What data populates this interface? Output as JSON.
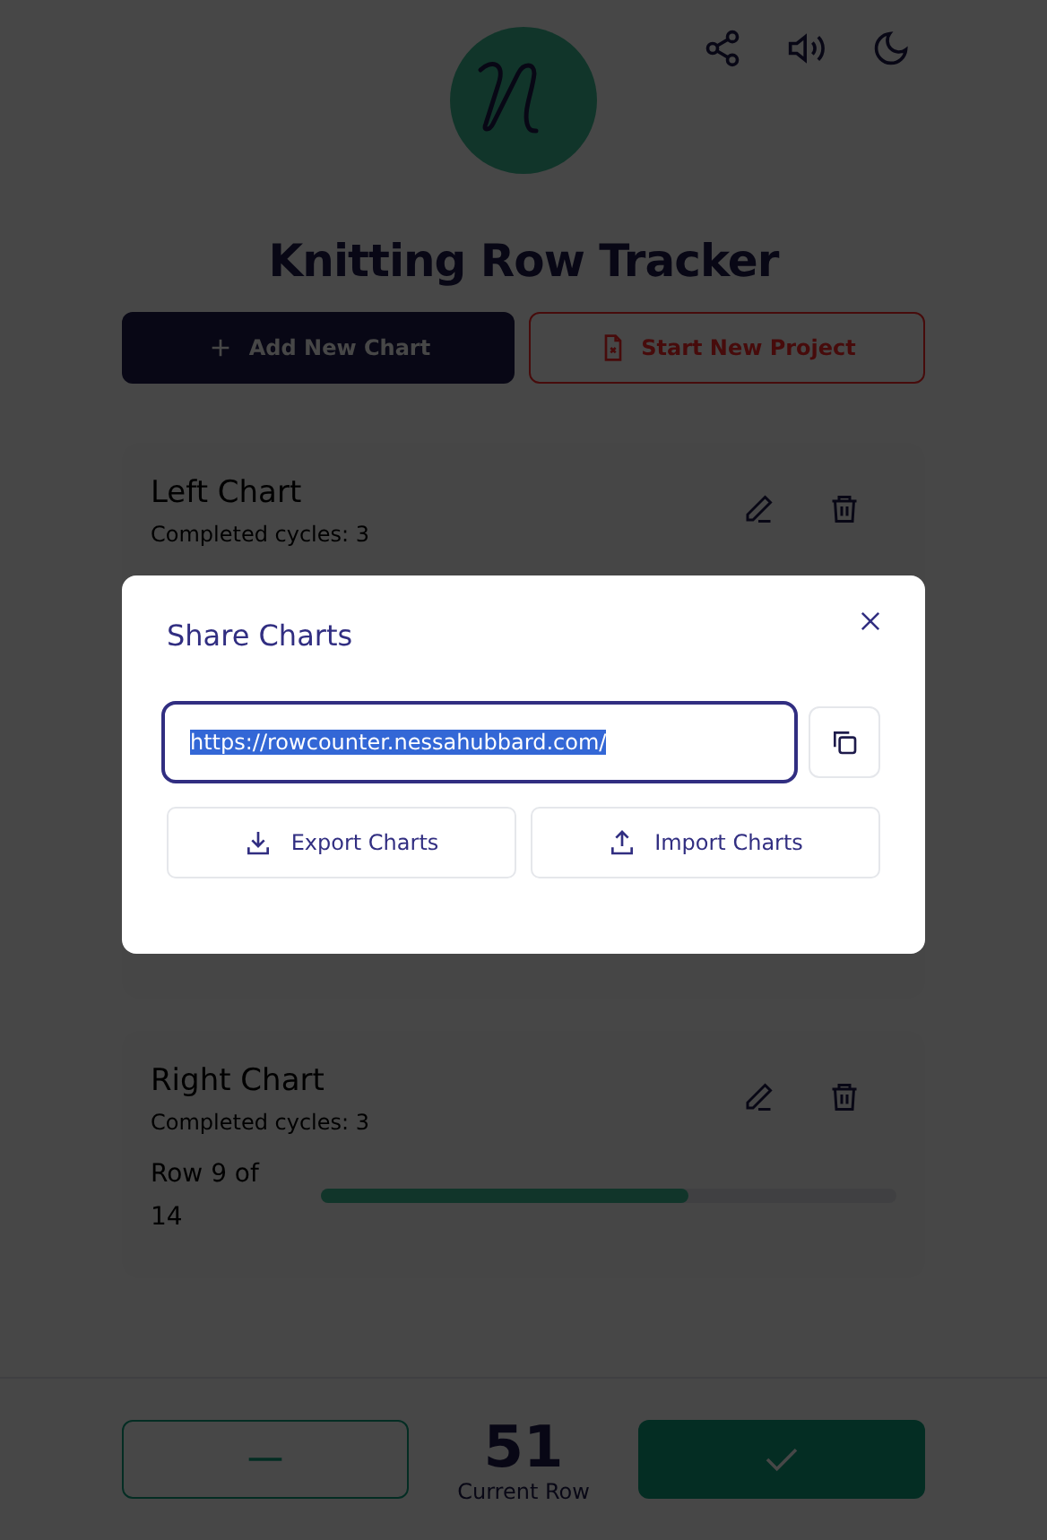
{
  "header": {
    "title": "Knitting Row Tracker"
  },
  "actions": [
    {
      "kind": "add",
      "label": "Add New Chart"
    },
    {
      "kind": "new-project",
      "label": "Start New Project"
    }
  ],
  "charts": [
    {
      "name": "Left Chart",
      "cycles": "Completed cycles: 3"
    },
    {
      "name": "Right Chart",
      "cycles": "Completed cycles: 3",
      "row_label": "Row 9 of 14",
      "level": 0.64
    }
  ],
  "footer": {
    "count": "51",
    "caption": "Current Row"
  },
  "dialog": {
    "title": "Share Charts",
    "url": "https://rowcounter.nessahubbard.com/",
    "url_selected": true,
    "buttons": [
      {
        "kind": "export",
        "label": "Export Charts"
      },
      {
        "kind": "import",
        "label": "Import Charts"
      }
    ]
  }
}
